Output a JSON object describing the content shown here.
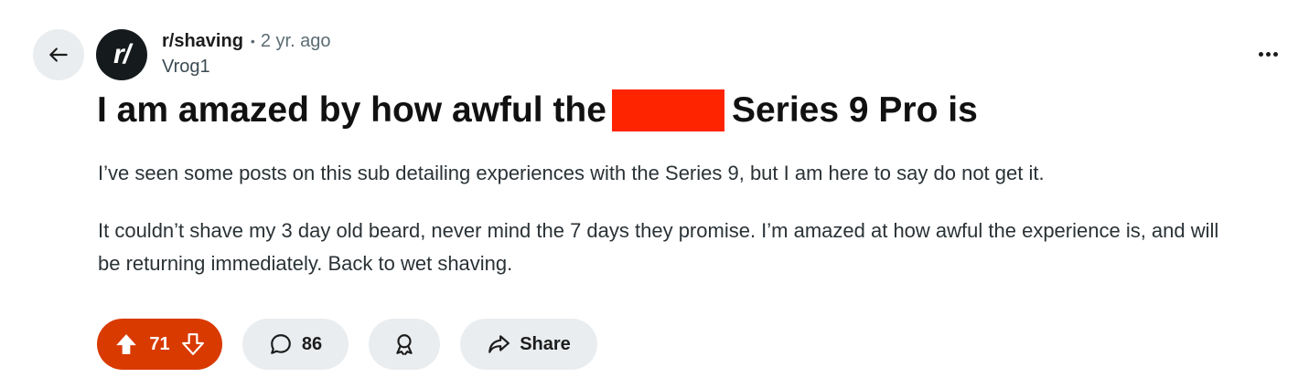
{
  "post": {
    "subreddit": "r/shaving",
    "subreddit_avatar_text": "r/",
    "separator": "•",
    "time_ago": "2 yr. ago",
    "author": "Vrog1",
    "title_before": "I am amazed by how awful the",
    "title_after": "Series 9 Pro is",
    "body": [
      "I’ve seen some posts on this sub detailing experiences with the Series 9, but I am here to say do not get it.",
      "It couldn’t shave my 3 day old beard, never mind the 7 days they promise. I’m amazed at how awful the experience is, and will be returning immediately. Back to wet shaving."
    ]
  },
  "actions": {
    "vote_count": "71",
    "comment_count": "86",
    "share_label": "Share"
  },
  "icons": {
    "back": "arrow-left-icon",
    "more": "more-horizontal-icon",
    "upvote": "upvote-arrow-icon",
    "downvote": "downvote-arrow-icon",
    "comment": "comment-bubble-icon",
    "award": "award-icon",
    "share": "share-arrow-icon"
  },
  "colors": {
    "vote_active": "#d93a00",
    "redaction": "#ff2400",
    "pill_background": "#eaedef",
    "avatar_background": "#151a1c"
  }
}
